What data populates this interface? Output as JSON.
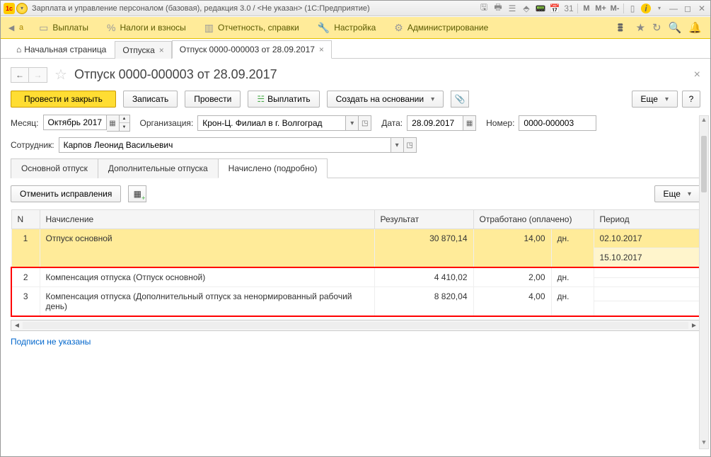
{
  "titlebar": {
    "app_title": "Зарплата и управление персоналом (базовая), редакция 3.0 / <Не указан>  (1С:Предприятие)"
  },
  "menubar": {
    "items": [
      {
        "label": "Выплаты"
      },
      {
        "label": "Налоги и взносы"
      },
      {
        "label": "Отчетность, справки"
      },
      {
        "label": "Настройка"
      },
      {
        "label": "Администрирование"
      }
    ]
  },
  "tabs": {
    "home": "Начальная страница",
    "t1": "Отпуска",
    "t2": "Отпуск 0000-000003 от 28.09.2017"
  },
  "doc": {
    "title": "Отпуск 0000-000003 от 28.09.2017"
  },
  "toolbar": {
    "post_close": "Провести и закрыть",
    "save": "Записать",
    "post": "Провести",
    "pay": "Выплатить",
    "create_based": "Создать на основании",
    "more": "Еще",
    "help": "?"
  },
  "form": {
    "month_label": "Месяц:",
    "month_value": "Октябрь 2017",
    "org_label": "Организация:",
    "org_value": "Крон-Ц. Филиал в г. Волгоград",
    "date_label": "Дата:",
    "date_value": "28.09.2017",
    "number_label": "Номер:",
    "number_value": "0000-000003",
    "employee_label": "Сотрудник:",
    "employee_value": "Карпов Леонид Васильевич"
  },
  "inner_tabs": {
    "t1": "Основной отпуск",
    "t2": "Дополнительные отпуска",
    "t3": "Начислено (подробно)"
  },
  "sub_toolbar": {
    "cancel_fix": "Отменить исправления",
    "more": "Еще"
  },
  "table": {
    "headers": {
      "n": "N",
      "accrual": "Начисление",
      "result": "Результат",
      "worked": "Отработано (оплачено)",
      "period": "Период"
    },
    "rows": [
      {
        "n": "1",
        "name": "Отпуск основной",
        "result": "30 870,14",
        "worked": "14,00",
        "unit": "дн.",
        "period_from": "02.10.2017",
        "period_to": "15.10.2017"
      },
      {
        "n": "2",
        "name": "Компенсация отпуска (Отпуск основной)",
        "result": "4 410,02",
        "worked": "2,00",
        "unit": "дн.",
        "period_from": "",
        "period_to": ""
      },
      {
        "n": "3",
        "name": "Компенсация отпуска (Дополнительный отпуск за ненормированный рабочий день)",
        "result": "8 820,04",
        "worked": "4,00",
        "unit": "дн.",
        "period_from": "",
        "period_to": ""
      }
    ]
  },
  "footer": {
    "signatures": "Подписи не указаны"
  },
  "nav_letter": "а"
}
